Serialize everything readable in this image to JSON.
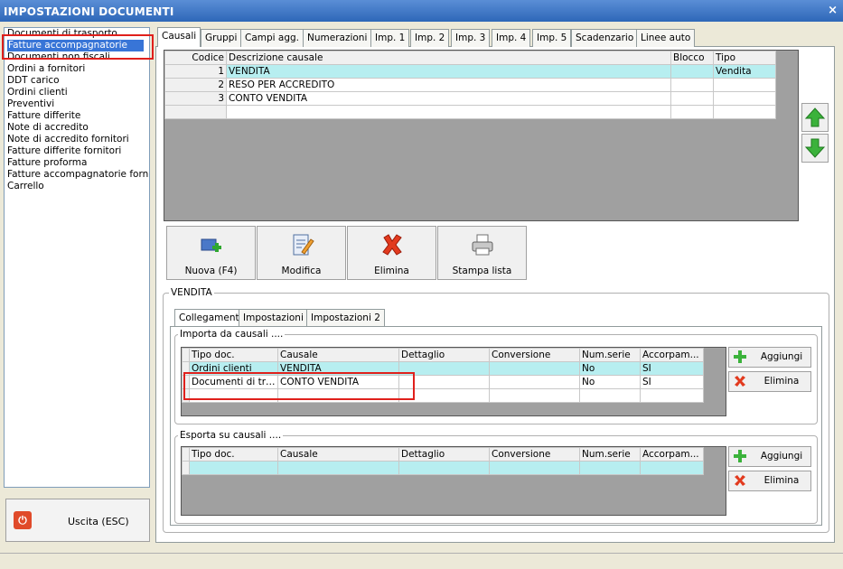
{
  "window": {
    "title": "IMPOSTAZIONI DOCUMENTI",
    "close_glyph": "×"
  },
  "left_list": {
    "items": [
      "Documenti di trasporto",
      "Fatture accompagnatorie",
      "Documenti non fiscali",
      "Ordini a fornitori",
      "DDT carico",
      "Ordini clienti",
      "Preventivi",
      "Fatture differite",
      "Note di accredito",
      "Note di accredito fornitori",
      "Fatture differite fornitori",
      "Fatture proforma",
      "Fatture accompagnatorie fornito",
      "Carrello"
    ],
    "selected": "Fatture accompagnatorie"
  },
  "exit_button": {
    "label": "Uscita (ESC)",
    "icon": "power-icon"
  },
  "tabs": [
    "Causali",
    "Gruppi",
    "Campi agg.",
    "Numerazioni",
    "Imp. 1",
    "Imp. 2",
    "Imp. 3",
    "Imp. 4",
    "Imp. 5",
    "Scadenzario",
    "Linee auto"
  ],
  "causali_grid": {
    "headers": [
      "Codice",
      "Descrizione causale",
      "Blocco",
      "Tipo"
    ],
    "rows": [
      {
        "codice": "1",
        "descrizione": "VENDITA",
        "blocco": "",
        "tipo": "Vendita"
      },
      {
        "codice": "2",
        "descrizione": "RESO PER ACCREDITO",
        "blocco": "",
        "tipo": ""
      },
      {
        "codice": "3",
        "descrizione": "CONTO VENDITA",
        "blocco": "",
        "tipo": ""
      }
    ]
  },
  "actions": {
    "nuova": "Nuova (F4)",
    "modifica": "Modifica",
    "elimina": "Elimina",
    "stampa": "Stampa lista"
  },
  "detail": {
    "group_title": "VENDITA",
    "subtabs": [
      "Collegamenti",
      "Impostazioni",
      "Impostazioni 2"
    ],
    "import": {
      "title": "Importa da causali ....",
      "headers": [
        "Tipo doc.",
        "Causale",
        "Dettaglio",
        "Conversione",
        "Num.serie",
        "Accorpam..."
      ],
      "rows": [
        {
          "tipo": "Ordini clienti",
          "causale": "VENDITA",
          "dettaglio": "",
          "conversione": "",
          "numserie": "No",
          "accorpam": "SI"
        },
        {
          "tipo": "Documenti di tra...",
          "causale": "CONTO VENDITA",
          "dettaglio": "",
          "conversione": "",
          "numserie": "No",
          "accorpam": "SI"
        }
      ],
      "add_label": "Aggiungi",
      "delete_label": "Elimina"
    },
    "export": {
      "title": "Esporta su causali ....",
      "headers": [
        "Tipo doc.",
        "Causale",
        "Dettaglio",
        "Conversione",
        "Num.serie",
        "Accorpam..."
      ],
      "add_label": "Aggiungi",
      "delete_label": "Elimina"
    }
  },
  "colors": {
    "highlight": "#e0201c",
    "selection": "#3875d7",
    "current_row": "#b7eef0",
    "title_bar": "#2e67b8"
  }
}
